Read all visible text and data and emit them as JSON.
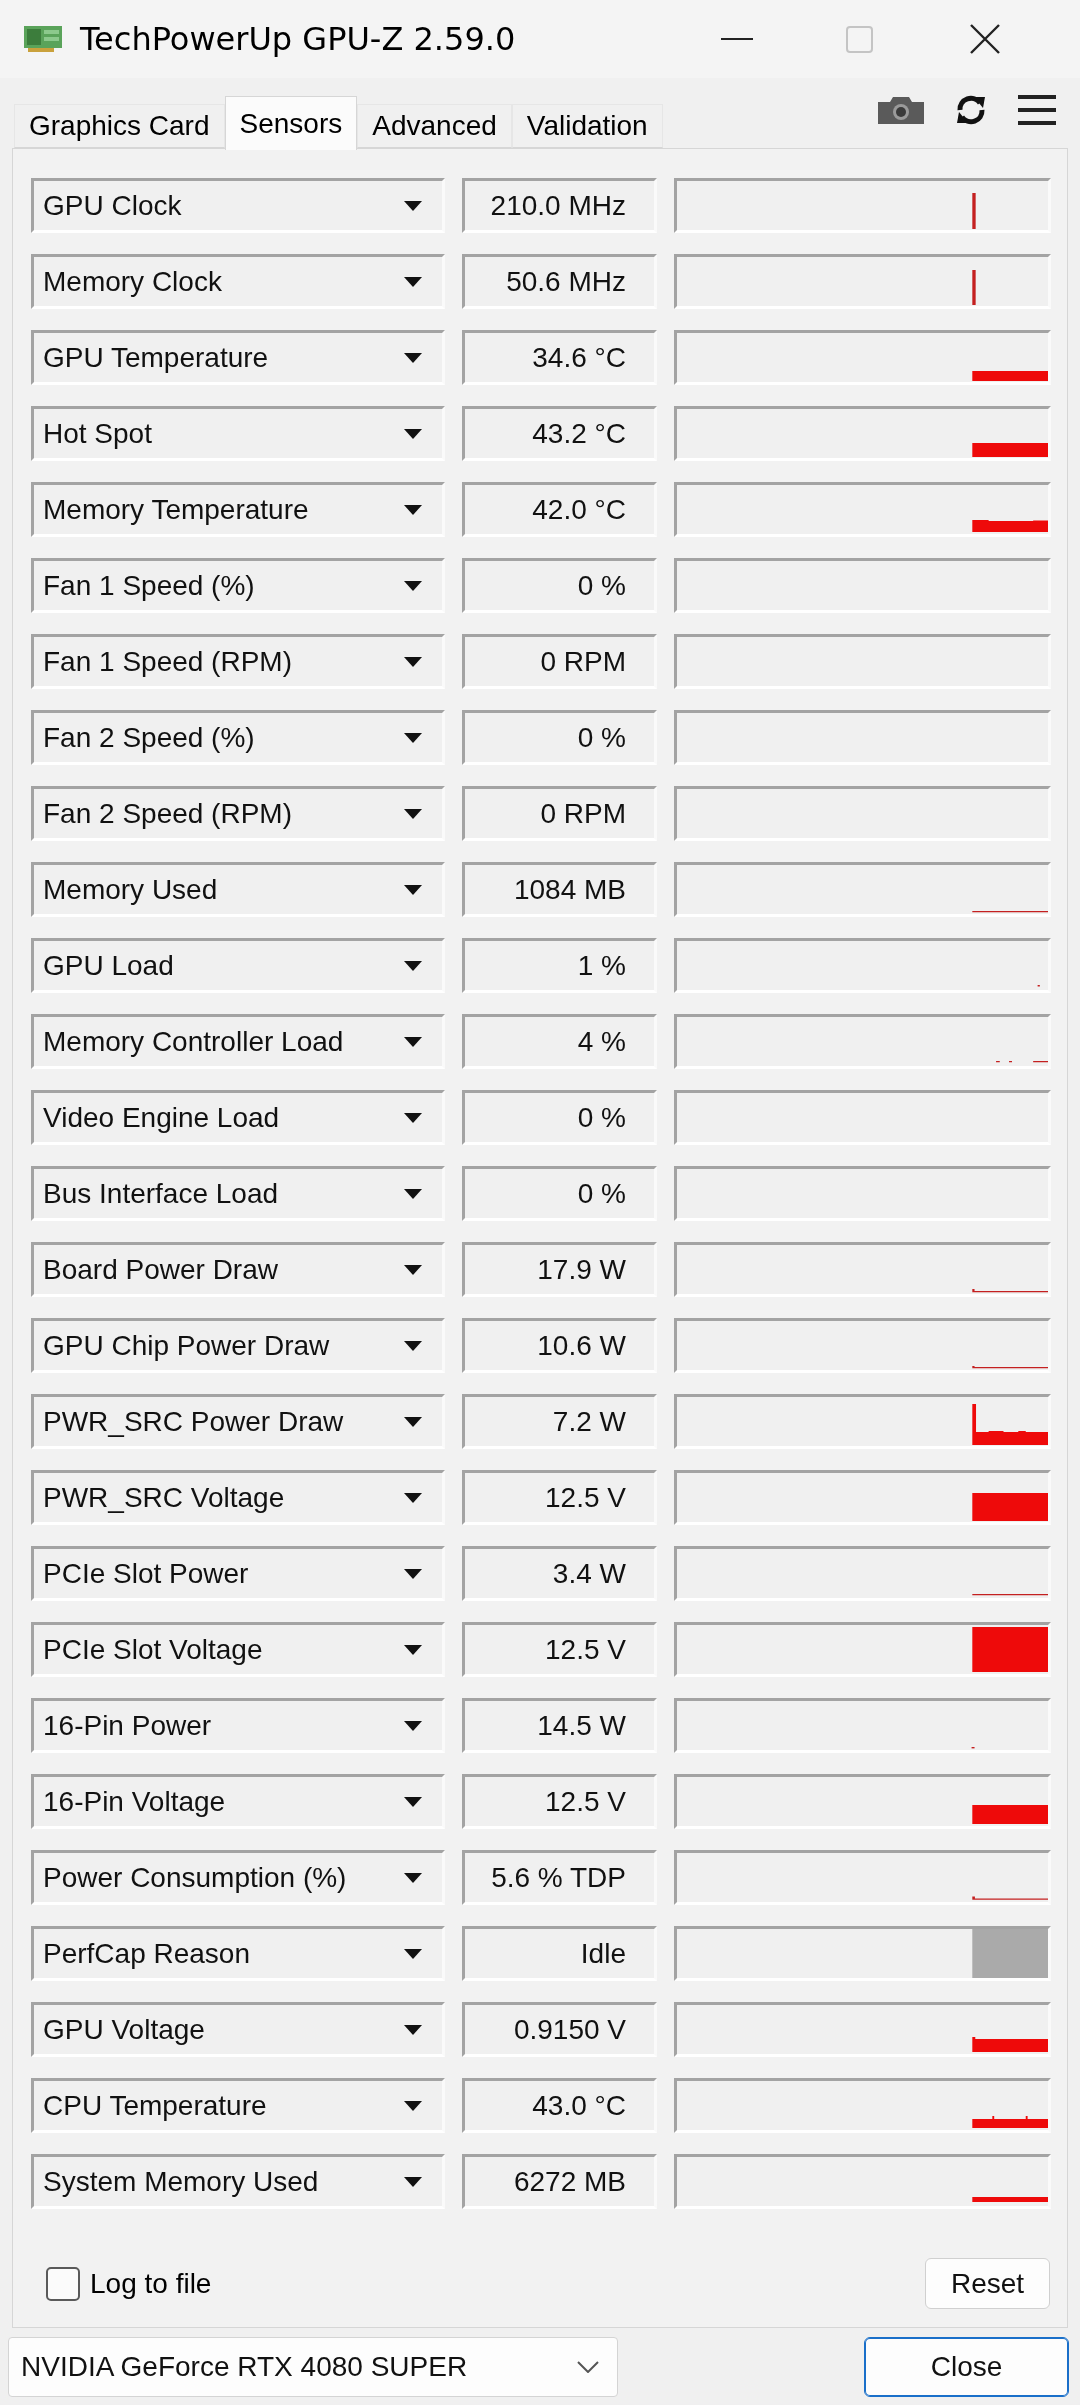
{
  "window": {
    "title": "TechPowerUp GPU-Z 2.59.0"
  },
  "tabs": [
    {
      "label": "Graphics Card",
      "selected": false
    },
    {
      "label": "Sensors",
      "selected": true
    },
    {
      "label": "Advanced",
      "selected": false
    },
    {
      "label": "Validation",
      "selected": false
    }
  ],
  "sensors": [
    {
      "name": "GPU Clock",
      "value": "210.0 MHz"
    },
    {
      "name": "Memory Clock",
      "value": "50.6 MHz"
    },
    {
      "name": "GPU Temperature",
      "value": "34.6 °C"
    },
    {
      "name": "Hot Spot",
      "value": "43.2 °C"
    },
    {
      "name": "Memory Temperature",
      "value": "42.0 °C"
    },
    {
      "name": "Fan 1 Speed (%)",
      "value": "0 %"
    },
    {
      "name": "Fan 1 Speed (RPM)",
      "value": "0 RPM"
    },
    {
      "name": "Fan 2 Speed (%)",
      "value": "0 %"
    },
    {
      "name": "Fan 2 Speed (RPM)",
      "value": "0 RPM"
    },
    {
      "name": "Memory Used",
      "value": "1084 MB"
    },
    {
      "name": "GPU Load",
      "value": "1 %"
    },
    {
      "name": "Memory Controller Load",
      "value": "4 %"
    },
    {
      "name": "Video Engine Load",
      "value": "0 %"
    },
    {
      "name": "Bus Interface Load",
      "value": "0 %"
    },
    {
      "name": "Board Power Draw",
      "value": "17.9 W"
    },
    {
      "name": "GPU Chip Power Draw",
      "value": "10.6 W"
    },
    {
      "name": "PWR_SRC Power Draw",
      "value": "7.2 W"
    },
    {
      "name": "PWR_SRC Voltage",
      "value": "12.5 V"
    },
    {
      "name": "PCIe Slot Power",
      "value": "3.4 W"
    },
    {
      "name": "PCIe Slot Voltage",
      "value": "12.5 V"
    },
    {
      "name": "16-Pin Power",
      "value": "14.5 W"
    },
    {
      "name": "16-Pin Voltage",
      "value": "12.5 V"
    },
    {
      "name": "Power Consumption (%)",
      "value": "5.6 % TDP"
    },
    {
      "name": "PerfCap Reason",
      "value": "Idle"
    },
    {
      "name": "GPU Voltage",
      "value": "0.9150 V"
    },
    {
      "name": "CPU Temperature",
      "value": "43.0 °C"
    },
    {
      "name": "System Memory Used",
      "value": "6272 MB"
    }
  ],
  "log_to_file": {
    "label": "Log to file",
    "checked": false
  },
  "reset_button": {
    "label": "Reset"
  },
  "gpu_select": {
    "value": "NVIDIA GeForce RTX 4080 SUPER"
  },
  "close_button": {
    "label": "Close"
  }
}
